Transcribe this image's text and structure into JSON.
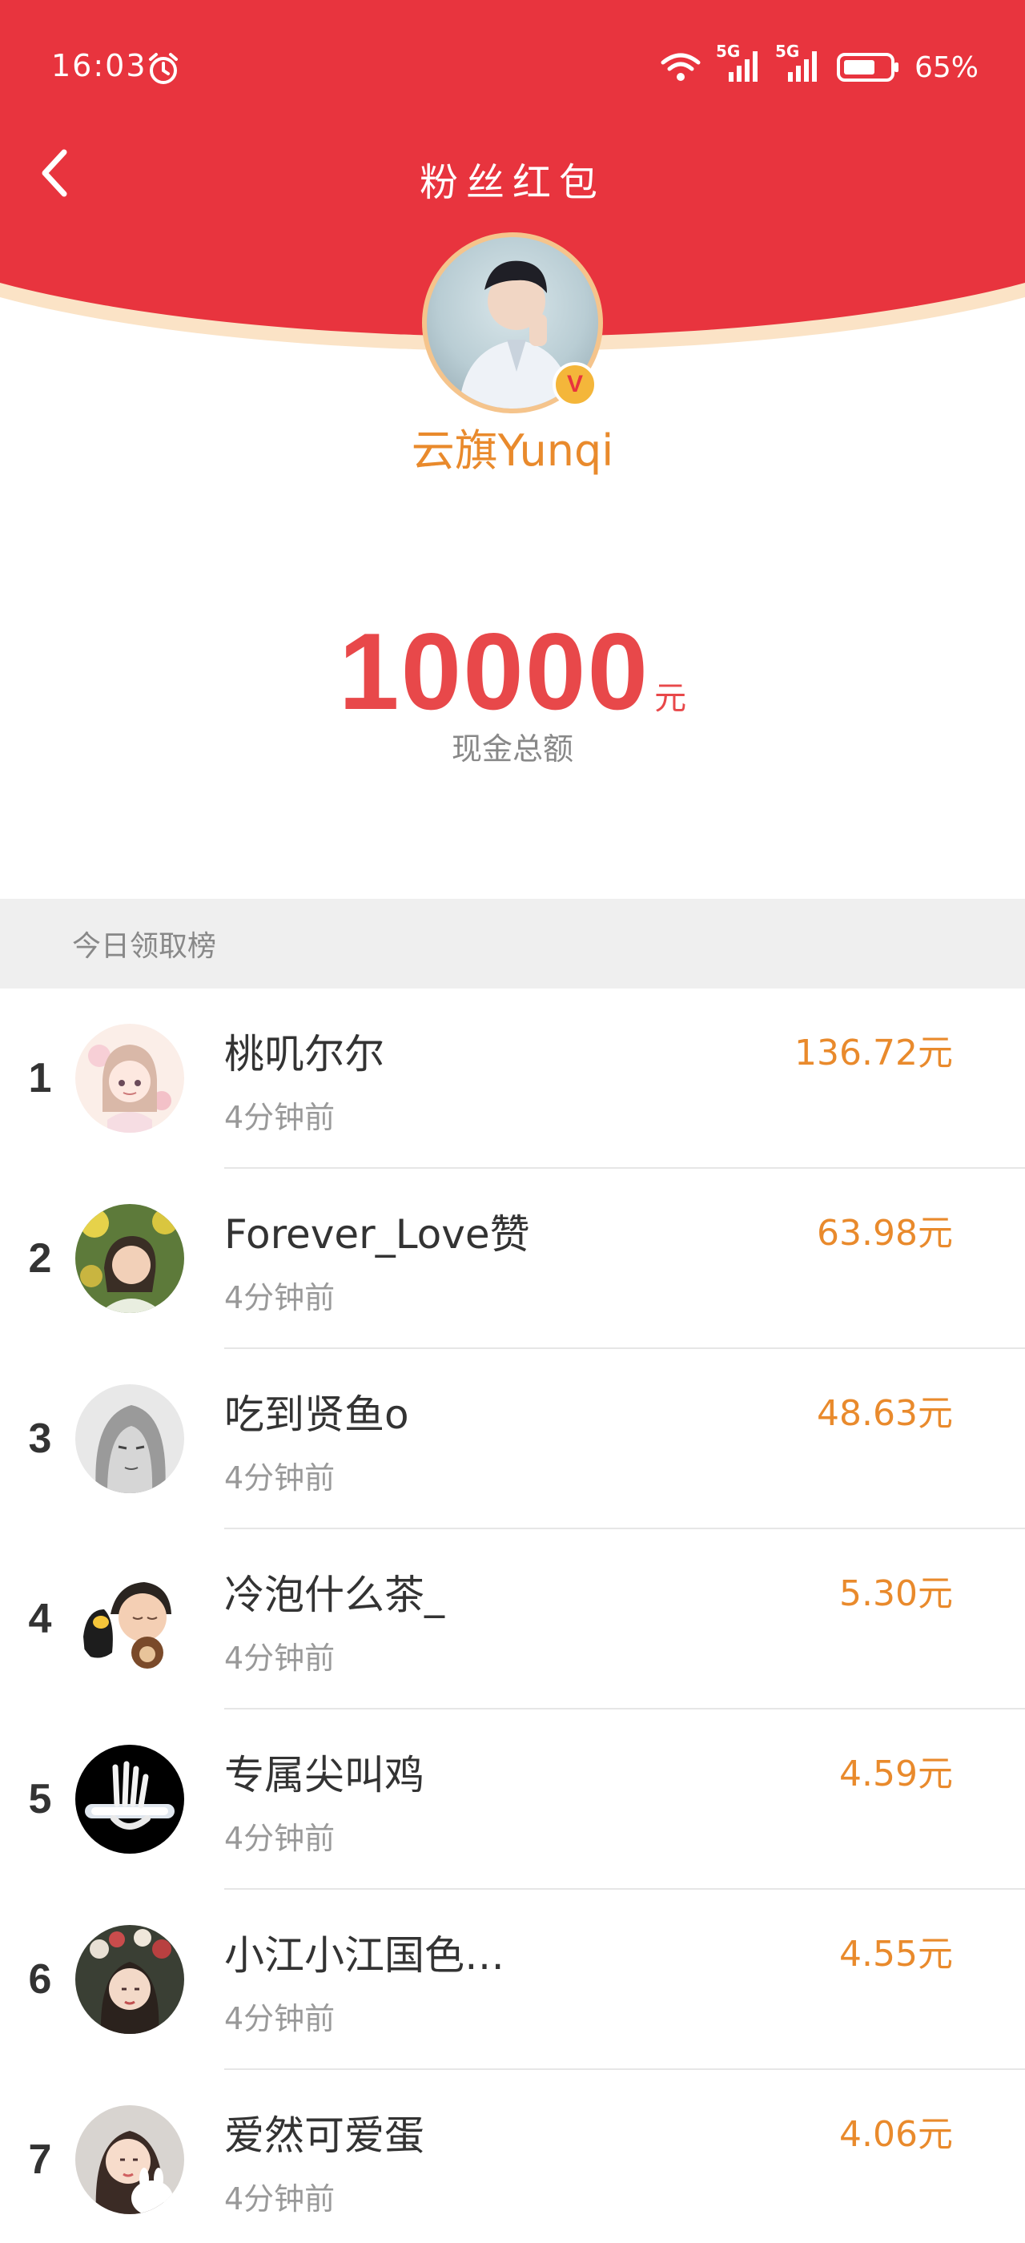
{
  "status_bar": {
    "time": "16:03",
    "network_tag_1": "5G",
    "network_tag_2": "5G",
    "battery": "65%"
  },
  "nav": {
    "title": "粉丝红包"
  },
  "host": {
    "name": "云旗Yunqi",
    "verified_mark": "V"
  },
  "amount": {
    "value": "10000",
    "unit": "元",
    "label": "现金总额"
  },
  "section": {
    "title": "今日领取榜"
  },
  "list": [
    {
      "rank": "1",
      "name": "桃叽尔尔",
      "time": "4分钟前",
      "amount": "136.72元"
    },
    {
      "rank": "2",
      "name": "Forever_Love赞",
      "time": "4分钟前",
      "amount": "63.98元"
    },
    {
      "rank": "3",
      "name": "吃到贤鱼o",
      "time": "4分钟前",
      "amount": "48.63元"
    },
    {
      "rank": "4",
      "name": "冷泡什么茶_",
      "time": "4分钟前",
      "amount": "5.30元"
    },
    {
      "rank": "5",
      "name": "专属尖叫鸡",
      "time": "4分钟前",
      "amount": "4.59元"
    },
    {
      "rank": "6",
      "name": "小江小江国色…",
      "time": "4分钟前",
      "amount": "4.55元"
    },
    {
      "rank": "7",
      "name": "爱然可爱蛋",
      "time": "4分钟前",
      "amount": "4.06元"
    }
  ],
  "colors": {
    "header_red": "#E8343E",
    "accent_orange": "#E98A2C",
    "amount_red": "#E8484A"
  }
}
